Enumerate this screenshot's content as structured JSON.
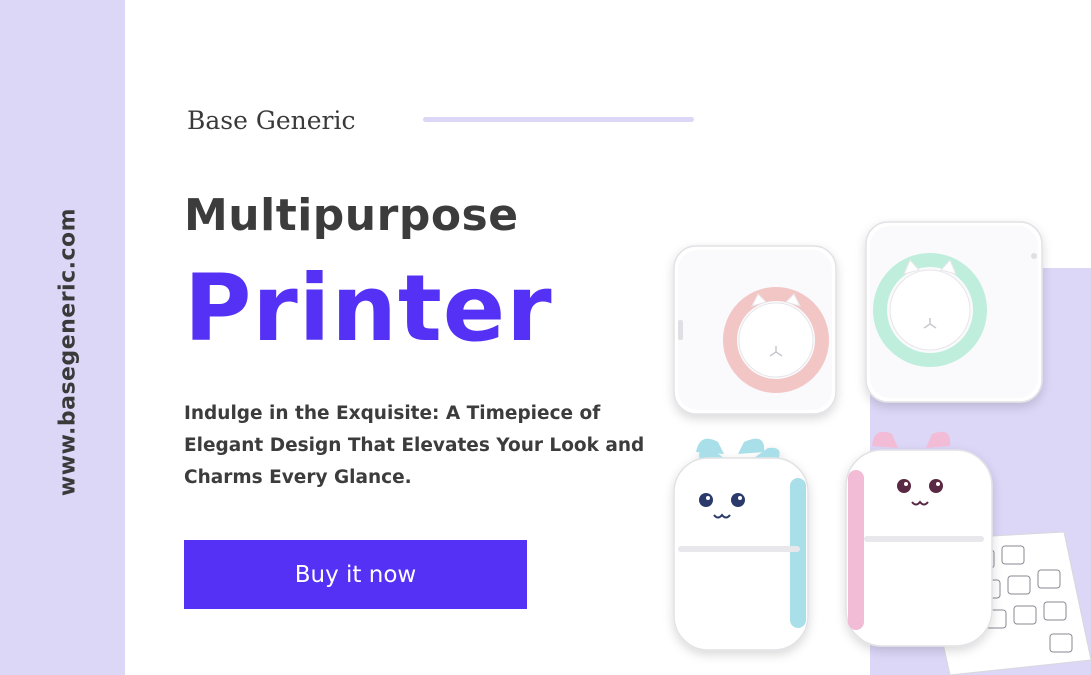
{
  "site": {
    "url": "www.basegeneric.com"
  },
  "brand": {
    "name": "Base Generic"
  },
  "hero": {
    "headline": "Multipurpose",
    "product": "Printer",
    "description": "Indulge in the Exquisite: A Timepiece of Elegant Design That Elevates Your Look and Charms Every Glance.",
    "cta_label": "Buy it now"
  },
  "colors": {
    "accent": "#5530f5",
    "band": "#dcd6f7",
    "text": "#3c3c3c",
    "background": "#ffffff"
  }
}
